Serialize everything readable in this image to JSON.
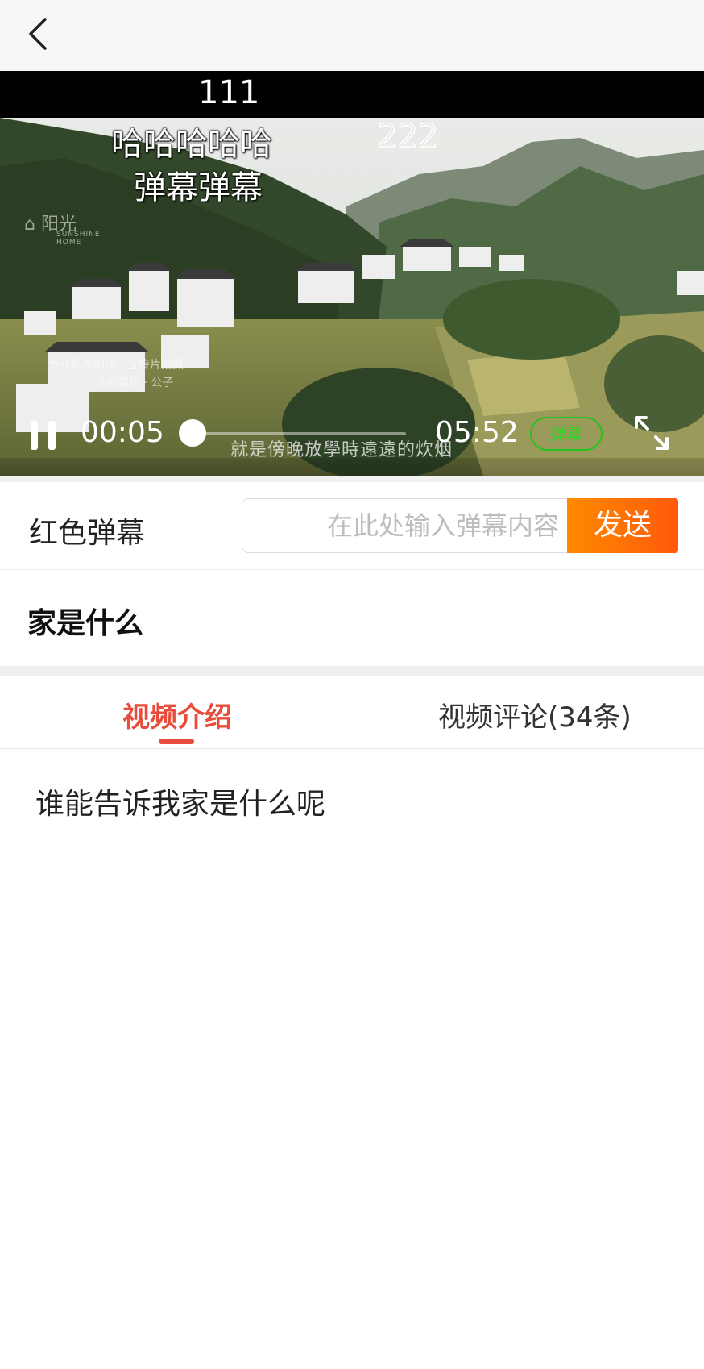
{
  "player": {
    "danmaku": [
      "111",
      "哈哈哈哈哈",
      "222",
      "弹幕弹幕"
    ],
    "current_time": "00:05",
    "duration": "05:52",
    "progress": 0.014,
    "danmaku_toggle_label": "弹幕",
    "watermark": "SUNSHINE HOME",
    "embedded_subtitle": "就是傍晚放學時遠遠的炊烟"
  },
  "danmaku_bar": {
    "color_label": "红色弹幕",
    "input_placeholder": "在此处输入弹幕内容",
    "send_label": "发送"
  },
  "video": {
    "title": "家是什么",
    "description": "谁能告诉我家是什么呢"
  },
  "tabs": [
    {
      "label": "视频介绍",
      "active": true
    },
    {
      "label": "视频评论(34条)",
      "active": false
    }
  ],
  "colors": {
    "accent": "#e74c3c",
    "send_gradient_start": "#ff8a00",
    "send_gradient_end": "#ff5a0a",
    "danmaku_toggle": "#22c41f"
  },
  "icons": [
    "back-arrow-icon",
    "pause-icon",
    "fullscreen-icon"
  ]
}
